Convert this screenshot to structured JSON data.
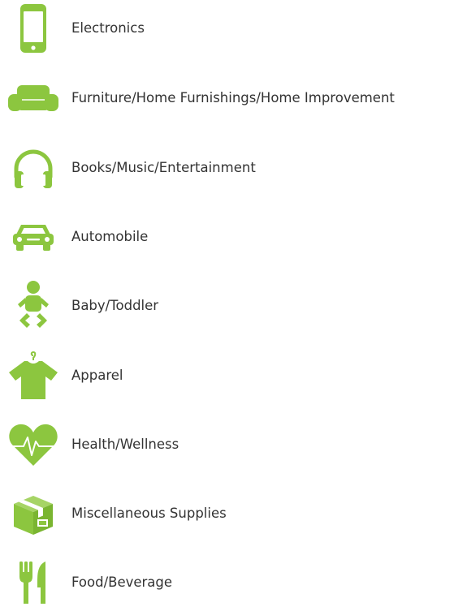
{
  "theme": {
    "icon_color": "#8cc63f",
    "text_color": "#333333"
  },
  "categories": [
    {
      "label": "Electronics",
      "icon": "smartphone-icon"
    },
    {
      "label": "Furniture/Home Furnishings/Home Improvement",
      "icon": "sofa-icon"
    },
    {
      "label": "Books/Music/Entertainment",
      "icon": "headphones-icon"
    },
    {
      "label": "Automobile",
      "icon": "car-icon"
    },
    {
      "label": "Baby/Toddler",
      "icon": "baby-icon"
    },
    {
      "label": "Apparel",
      "icon": "tshirt-icon"
    },
    {
      "label": "Health/Wellness",
      "icon": "heart-pulse-icon"
    },
    {
      "label": "Miscellaneous Supplies",
      "icon": "box-icon"
    },
    {
      "label": "Food/Beverage",
      "icon": "fork-knife-icon"
    }
  ]
}
